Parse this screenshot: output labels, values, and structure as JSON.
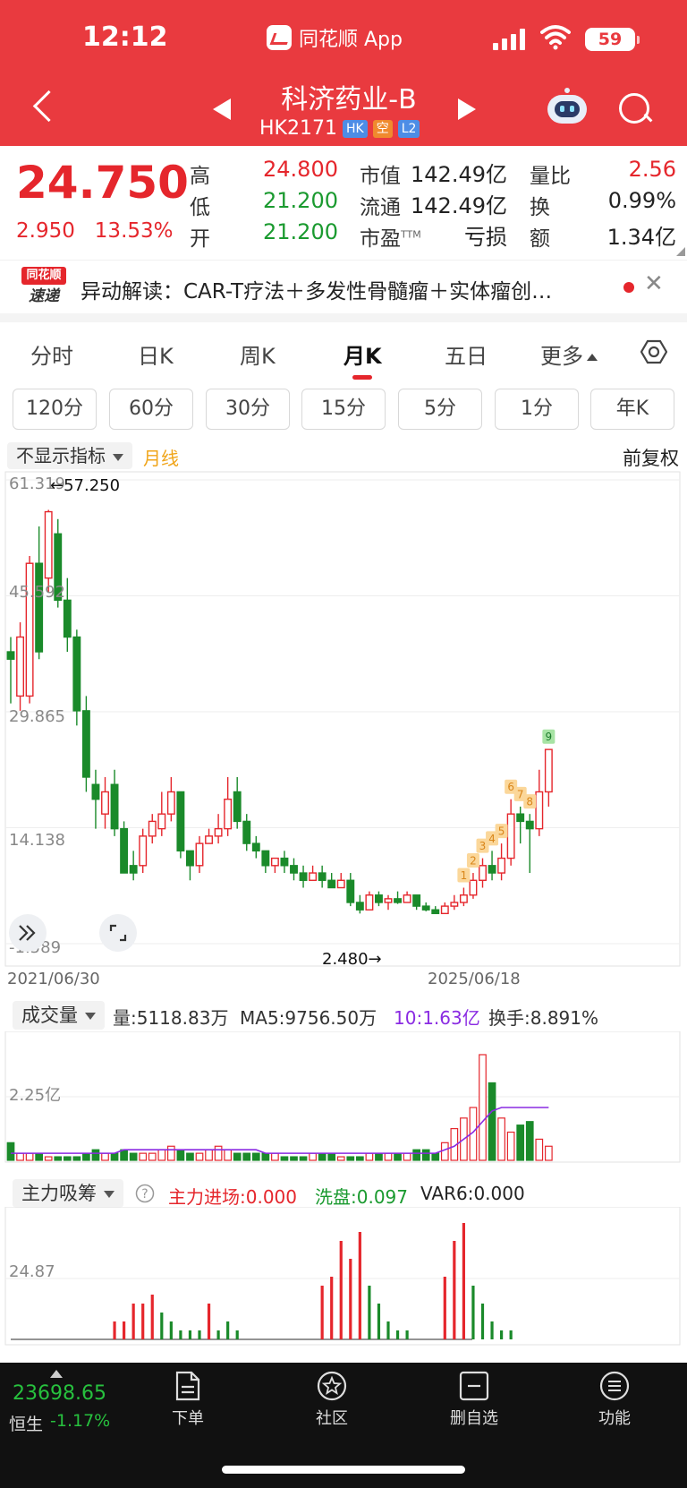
{
  "status_bar": {
    "time": "12:12",
    "app_name": "同花顺 App",
    "battery": "59"
  },
  "header": {
    "stock_name": "科济药业-B",
    "stock_code": "HK2171",
    "tags": [
      "HK",
      "空",
      "L2"
    ]
  },
  "quote": {
    "price": "24.750",
    "change": "2.950",
    "change_pct": "13.53%",
    "high_label": "高",
    "high": "24.800",
    "low_label": "低",
    "low": "21.200",
    "open_label": "开",
    "open": "21.200",
    "mcap_label": "市值",
    "mcap": "142.49亿",
    "float_label": "流通",
    "float": "142.49亿",
    "pe_label": "市盈",
    "pe_sup": "TTM",
    "pe": "亏损",
    "vol_ratio_label": "量比",
    "vol_ratio": "2.56",
    "turnover_label": "换",
    "turnover": "0.99%",
    "amount_label": "额",
    "amount": "1.34亿"
  },
  "news": {
    "logo_top": "同花顺",
    "logo_bottom": "速递",
    "text": "异动解读：CAR-T疗法＋多发性骨髓瘤＋实体瘤创…"
  },
  "tabs": [
    "分时",
    "日K",
    "周K",
    "月K",
    "五日",
    "更多"
  ],
  "active_tab": "月K",
  "periods": [
    "120分",
    "60分",
    "30分",
    "15分",
    "5分",
    "1分",
    "年K"
  ],
  "indicator_bar": {
    "select": "不显示指标",
    "line_label": "月线",
    "adjust": "前复权"
  },
  "colors": {
    "up": "#e5262c",
    "down": "#1a8a2a",
    "header": "#e93a3f"
  },
  "chart_data": [
    {
      "type": "candlestick",
      "title": "",
      "y_ticks": [
        "61.319",
        "45.592",
        "29.865",
        "14.138",
        "-1.589"
      ],
      "ylim": [
        -1.589,
        61.319
      ],
      "x_labels": [
        "2021/06/30",
        "2025/06/18"
      ],
      "annotations": {
        "max_label": "←57.250",
        "min_label": "2.480→",
        "td_signals": [
          "1",
          "2",
          "3",
          "4",
          "5",
          "6",
          "7",
          "8",
          "9"
        ]
      },
      "candles": [
        [
          38,
          37,
          40,
          31
        ],
        [
          32,
          40,
          42,
          30
        ],
        [
          32,
          50,
          51,
          31
        ],
        [
          50,
          38,
          55,
          37
        ],
        [
          48,
          57,
          57.25,
          46
        ],
        [
          54,
          45,
          56,
          44
        ],
        [
          45,
          40,
          48,
          38
        ],
        [
          40,
          30,
          41,
          28
        ],
        [
          30,
          21,
          32,
          19
        ],
        [
          20,
          18,
          22,
          14
        ],
        [
          16,
          19,
          21,
          14
        ],
        [
          20,
          14,
          22,
          13
        ],
        [
          14,
          8,
          15,
          8
        ],
        [
          9,
          8,
          11,
          7
        ],
        [
          9,
          13,
          14,
          8
        ],
        [
          13,
          15,
          16,
          12
        ],
        [
          14,
          16,
          19,
          13
        ],
        [
          16,
          19,
          21,
          15
        ],
        [
          19,
          11,
          19,
          10
        ],
        [
          11,
          9,
          11,
          7
        ],
        [
          9,
          12,
          13,
          8
        ],
        [
          12,
          13,
          14,
          12
        ],
        [
          13,
          14,
          16,
          12
        ],
        [
          14,
          18,
          21,
          13
        ],
        [
          19,
          15,
          21,
          14
        ],
        [
          15,
          12,
          16,
          11
        ],
        [
          12,
          11,
          13,
          10
        ],
        [
          11,
          9,
          11,
          8
        ],
        [
          9,
          10,
          10,
          8
        ],
        [
          10,
          9,
          11,
          8
        ],
        [
          9,
          8,
          10,
          7
        ],
        [
          8,
          7,
          9,
          6
        ],
        [
          7,
          8,
          9,
          7
        ],
        [
          8,
          7,
          9,
          6
        ],
        [
          7,
          6,
          8,
          6
        ],
        [
          6,
          7,
          8,
          6
        ],
        [
          7,
          4,
          8,
          3.5
        ],
        [
          4,
          3,
          5,
          2.5
        ],
        [
          3,
          5,
          5.5,
          3
        ],
        [
          5,
          4,
          5.5,
          3.5
        ],
        [
          4,
          4.5,
          5,
          3
        ],
        [
          4.5,
          4,
          5.5,
          3.8
        ],
        [
          4,
          5,
          5.5,
          4
        ],
        [
          5,
          3.5,
          5,
          3
        ],
        [
          3.5,
          3,
          4,
          2.8
        ],
        [
          3,
          2.5,
          3.5,
          2.48
        ],
        [
          2.5,
          3.5,
          4,
          2.48
        ],
        [
          3.5,
          4,
          5,
          3
        ],
        [
          4,
          5,
          6,
          3.5
        ],
        [
          5,
          7,
          8,
          4.5
        ],
        [
          7,
          9,
          10,
          6
        ],
        [
          9,
          8,
          11,
          7
        ],
        [
          8,
          10,
          12,
          7
        ],
        [
          10,
          16,
          18,
          9
        ],
        [
          16,
          15,
          17,
          12
        ],
        [
          15,
          14,
          16,
          8
        ],
        [
          14,
          19,
          22,
          13
        ],
        [
          19,
          24.75,
          24.8,
          17
        ]
      ]
    },
    {
      "type": "bar",
      "title": "成交量",
      "y_tick": "2.25亿",
      "values": [
        5,
        2,
        2,
        2,
        1,
        1,
        1,
        1,
        2,
        3,
        2,
        2,
        3,
        2,
        2,
        2,
        3,
        4,
        3,
        2,
        2,
        3,
        4,
        3,
        2,
        2,
        2,
        2,
        2,
        1,
        1,
        1,
        2,
        2,
        2,
        1,
        1,
        1,
        2,
        2,
        2,
        2,
        2,
        3,
        3,
        2,
        5,
        9,
        12,
        15,
        30,
        22,
        12,
        8,
        10,
        11,
        6,
        4
      ],
      "series": [
        {
          "name": "MA5",
          "values": [
            2,
            2,
            2,
            2,
            2,
            2,
            2,
            2,
            2,
            2,
            2,
            2,
            3,
            3,
            3,
            3,
            3,
            3,
            3,
            3,
            3,
            3,
            3,
            3,
            3,
            3,
            3,
            2,
            2,
            2,
            2,
            2,
            2,
            2,
            2,
            2,
            2,
            2,
            2,
            2,
            2,
            2,
            2,
            2,
            2,
            2,
            3,
            4,
            6,
            8,
            11,
            14,
            15,
            15,
            15,
            15,
            15,
            15
          ]
        }
      ],
      "legend": [
        "量:5118.83万",
        "MA5:9756.50万",
        "10:1.63亿",
        "换手:8.891%"
      ]
    },
    {
      "type": "bar",
      "title": "主力吸筹",
      "y_tick": "24.87",
      "values": [
        0,
        0,
        0,
        0,
        0,
        0,
        0,
        0,
        0,
        0,
        0,
        2,
        2,
        4,
        4,
        5,
        3,
        2,
        1,
        1,
        1,
        4,
        1,
        2,
        1,
        0,
        0,
        0,
        0,
        0,
        0,
        0,
        0,
        6,
        7,
        11,
        9,
        12,
        6,
        4,
        2,
        1,
        1,
        0,
        0,
        0,
        7,
        11,
        13,
        6,
        4,
        2,
        1,
        1,
        0,
        0,
        0,
        0
      ],
      "colors": [
        "r",
        "r",
        "r",
        "r",
        "r",
        "r",
        "r",
        "r",
        "r",
        "r",
        "r",
        "r",
        "r",
        "r",
        "r",
        "r",
        "g",
        "g",
        "g",
        "g",
        "g",
        "r",
        "g",
        "g",
        "g",
        "g",
        "g",
        "g",
        "g",
        "g",
        "g",
        "g",
        "g",
        "r",
        "r",
        "r",
        "r",
        "r",
        "g",
        "g",
        "g",
        "g",
        "g",
        "g",
        "g",
        "g",
        "r",
        "r",
        "r",
        "g",
        "g",
        "g",
        "g",
        "g",
        "g",
        "g",
        "g",
        "g"
      ],
      "legend": [
        "主力进场:0.000",
        "洗盘:0.097",
        "VAR6:0.000"
      ]
    }
  ],
  "bottom_nav": {
    "index_value": "23698.65",
    "index_name": "恒生",
    "index_change": "-1.17%",
    "items": [
      "下单",
      "社区",
      "删自选",
      "功能"
    ]
  }
}
